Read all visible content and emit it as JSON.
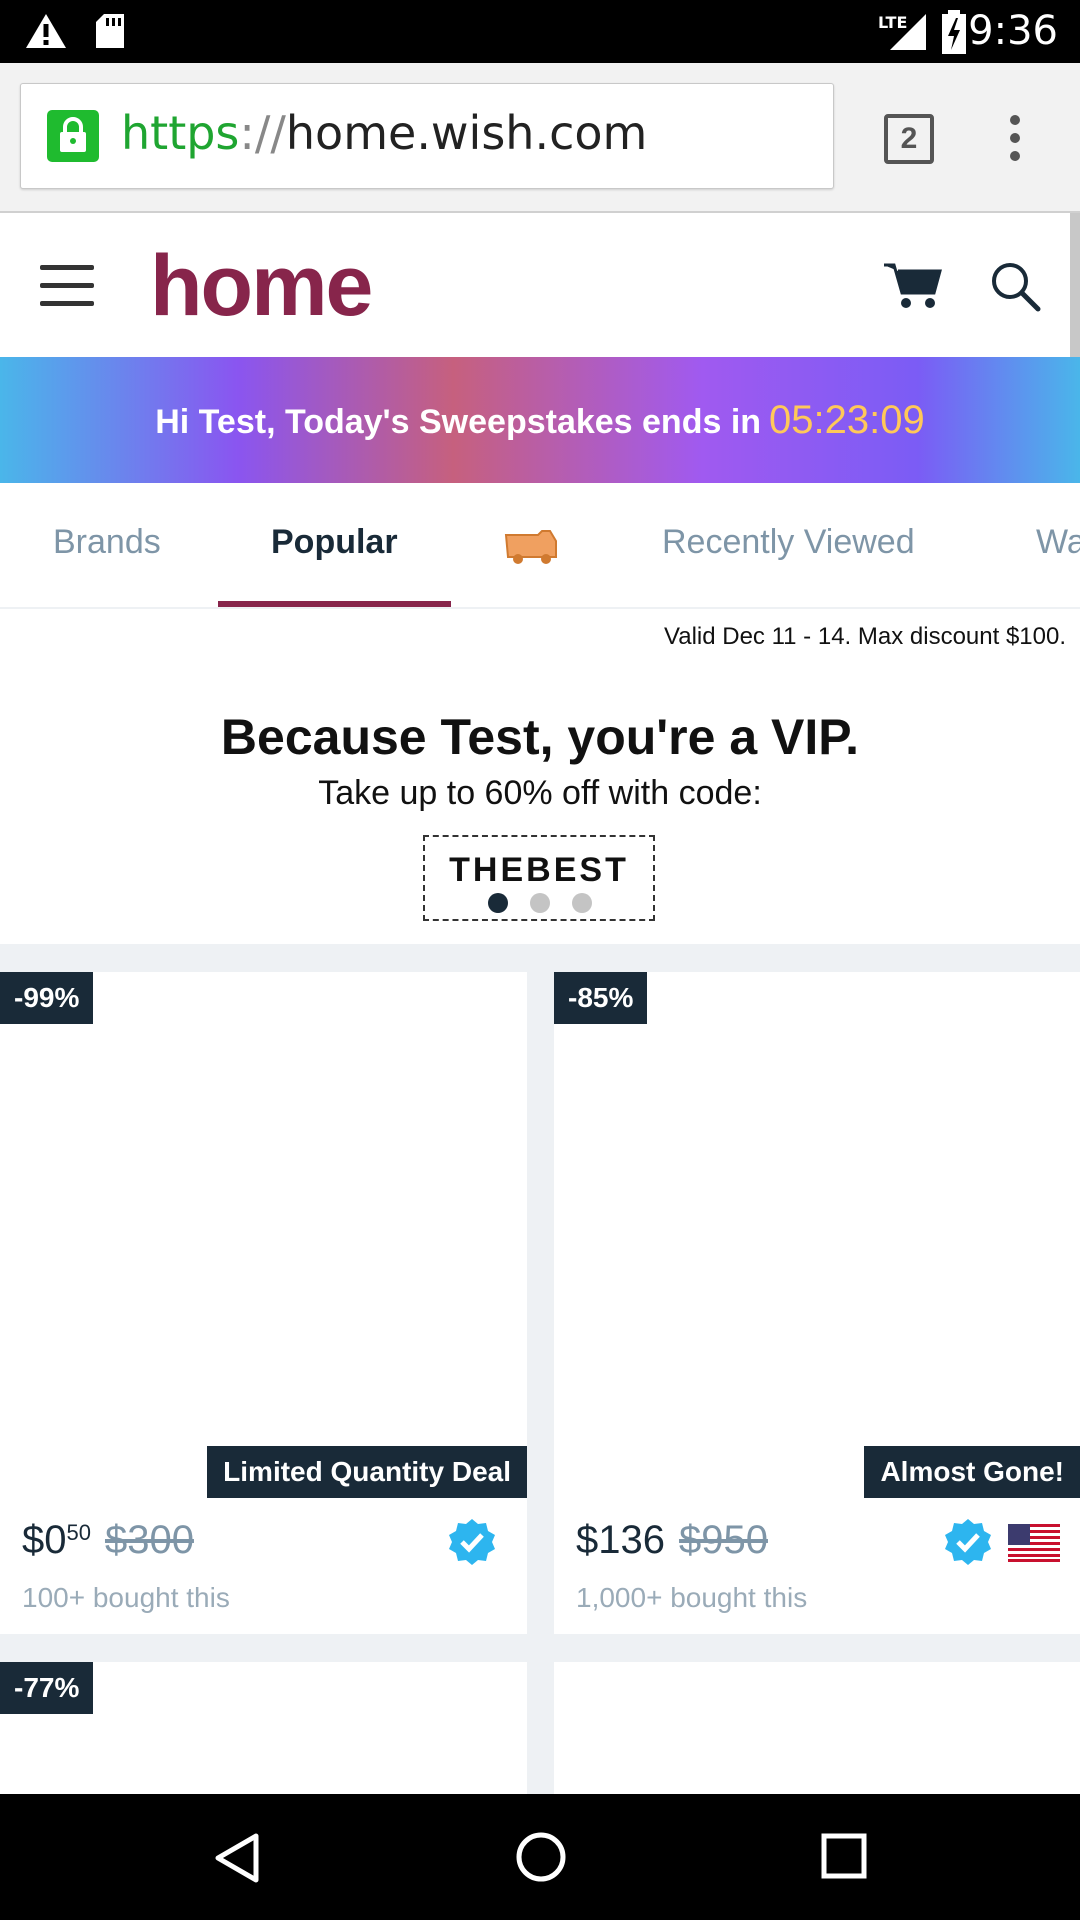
{
  "status_bar": {
    "time": "9:36",
    "network": "LTE"
  },
  "browser": {
    "url_scheme": "https",
    "url_sep": "://",
    "url_host": "home.wish.com",
    "tab_count": "2"
  },
  "header": {
    "logo": "home"
  },
  "banner": {
    "text": "Hi Test, Today's Sweepstakes ends in",
    "timer": "05:23:09"
  },
  "tabs": [
    "Brands",
    "Popular",
    "Recently Viewed",
    "Wa"
  ],
  "promo": {
    "valid": "Valid Dec 11 - 14. Max discount $100.",
    "title": "Because Test, you're a VIP.",
    "subtitle": "Take up to 60% off with code:",
    "code": "THEBEST"
  },
  "products": [
    {
      "discount": "-99%",
      "badge": "Limited Quantity Deal",
      "price_main": "$0",
      "price_cents": "50",
      "original_price": "$300",
      "bought": "100+ bought this"
    },
    {
      "discount": "-85%",
      "badge": "Almost Gone!",
      "price_main": "$136",
      "price_cents": "",
      "original_price": "$950",
      "bought": "1,000+ bought this"
    },
    {
      "discount": "-77%"
    }
  ],
  "colors": {
    "brand": "#87254b",
    "dark": "#192a38",
    "muted": "#7e95a7",
    "timer": "#ffc859",
    "verified": "#2db5ef"
  }
}
